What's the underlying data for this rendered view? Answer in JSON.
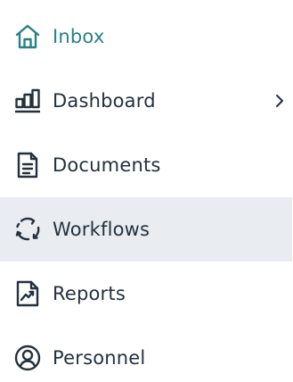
{
  "sidebar": {
    "items": [
      {
        "id": "inbox",
        "label": "Inbox",
        "icon": "home-icon",
        "selected": true,
        "hovered": false,
        "has_chevron": false
      },
      {
        "id": "dashboard",
        "label": "Dashboard",
        "icon": "bar-chart-icon",
        "selected": false,
        "hovered": false,
        "has_chevron": true
      },
      {
        "id": "documents",
        "label": "Documents",
        "icon": "document-icon",
        "selected": false,
        "hovered": false,
        "has_chevron": false
      },
      {
        "id": "workflows",
        "label": "Workflows",
        "icon": "refresh-cycle-icon",
        "selected": false,
        "hovered": true,
        "has_chevron": false
      },
      {
        "id": "reports",
        "label": "Reports",
        "icon": "trend-chart-icon",
        "selected": false,
        "hovered": false,
        "has_chevron": false
      },
      {
        "id": "personnel",
        "label": "Personnel",
        "icon": "user-circle-icon",
        "selected": false,
        "hovered": false,
        "has_chevron": false
      }
    ]
  },
  "colors": {
    "selected_text": "#2a8184",
    "text": "#24313d",
    "hover_bg": "#e9edf1"
  }
}
